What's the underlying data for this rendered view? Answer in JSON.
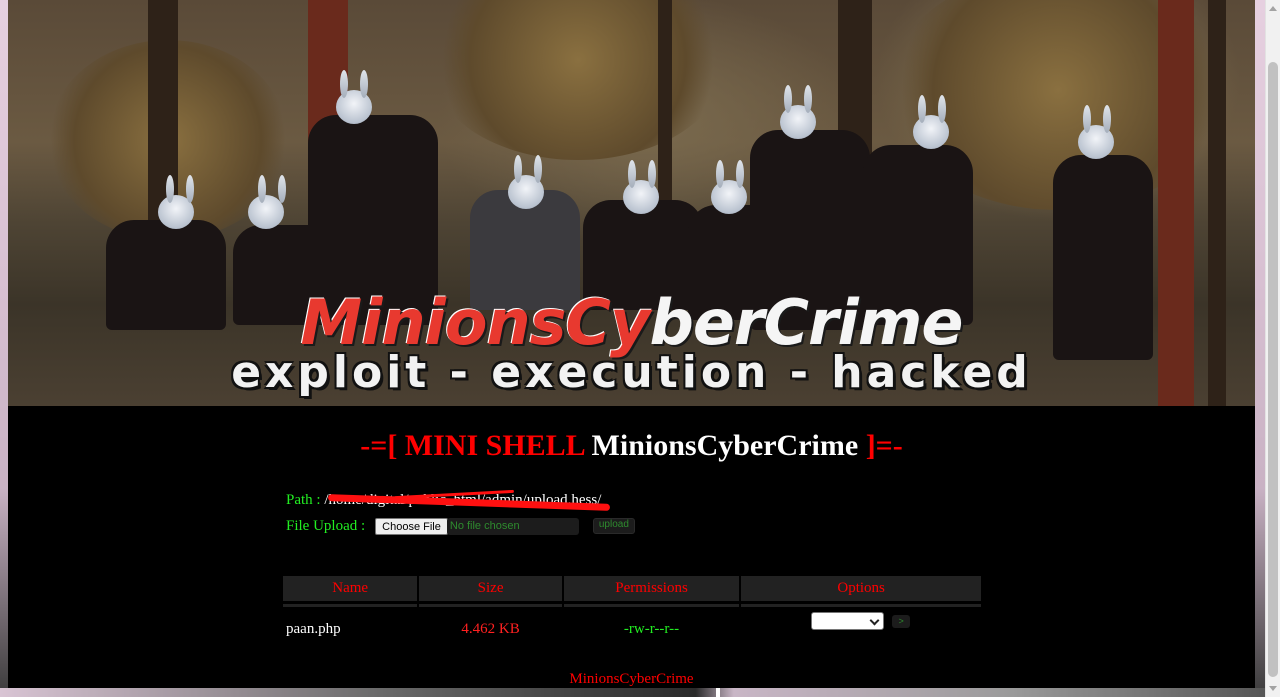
{
  "banner": {
    "brand_red": "MinionsCy",
    "brand_white": "berCrime",
    "tagline": "exploit - execution - hacked"
  },
  "shell": {
    "title_red": "-=[ MINI SHELL ",
    "title_white": "MinionsCyberCrime",
    "title_red_end": " ]=-",
    "path_label": "Path : ",
    "path_value": "/home/digital/public_html/admin/upload.hess/",
    "upload_label": "File Upload : ",
    "choose_label": "Choose File",
    "no_file": "No file chosen",
    "upload_button": "upload"
  },
  "table": {
    "headers": [
      "Name",
      "Size",
      "Permissions",
      "Options"
    ],
    "rows": [
      {
        "name": "paan.php",
        "size": "4.462 KB",
        "perms": "-rw-r--r--",
        "go": ">"
      }
    ]
  },
  "footer": "MinionsCyberCrime",
  "colors": {
    "accent_red": "#ff0000",
    "accent_green": "#22ee22",
    "panel_bg": "#000000"
  }
}
